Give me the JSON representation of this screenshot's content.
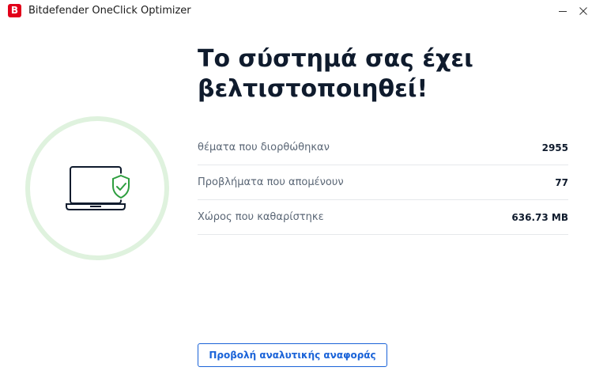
{
  "titlebar": {
    "app_logo_letter": "B",
    "app_title": "Bitdefender OneClick Optimizer"
  },
  "main": {
    "heading_line1": "Το σύστημά σας έχει",
    "heading_line2": "βελτιστοποιηθεί!",
    "stats": [
      {
        "label": "θέματα που διορθώθηκαν",
        "value": "2955"
      },
      {
        "label": "Προβλήματα που απομένουν",
        "value": "77"
      },
      {
        "label": "Χώρος που καθαρίστηκε",
        "value": "636.73 MB"
      }
    ],
    "report_button_label": "Προβολή αναλυτικής αναφοράς"
  },
  "icons": {
    "app_logo": "bitdefender-logo-icon",
    "illustration": "laptop-shield-check-icon",
    "minimize": "minimize-icon",
    "close": "close-icon"
  },
  "colors": {
    "brand_red": "#e2001a",
    "accent_blue": "#1a63d8",
    "success_green": "#2e9e3f",
    "ring_green": "#dff2de",
    "heading_text": "#0f1b2d"
  }
}
